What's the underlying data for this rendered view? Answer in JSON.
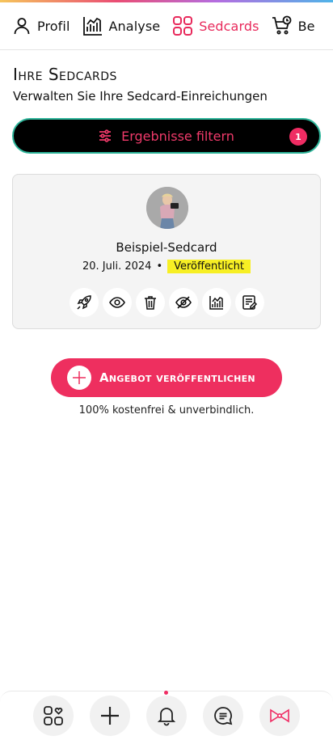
{
  "tabs": [
    {
      "label": "Profil",
      "icon": "user-icon",
      "active": false
    },
    {
      "label": "Analyse",
      "icon": "chart-icon",
      "active": false
    },
    {
      "label": "Sedcards",
      "icon": "grid-icon",
      "active": true
    },
    {
      "label": "Be",
      "icon": "cart-clock-icon",
      "active": false
    }
  ],
  "header": {
    "title": "Ihre Sedcards",
    "subtitle": "Verwalten Sie Ihre Sedcard-Einreichungen"
  },
  "filter": {
    "label": "Ergebnisse filtern",
    "badge": "1"
  },
  "card": {
    "title": "Beispiel-Sedcard",
    "date": "20. Juli. 2024",
    "separator": "•",
    "status": "Veröffentlicht",
    "actions": [
      "rocket-icon",
      "eye-icon",
      "trash-icon",
      "eye-off-icon",
      "chart-icon",
      "edit-note-icon"
    ]
  },
  "cta": {
    "label": "Angebot veröffentlichen",
    "note": "100% kostenfrei & unverbindlich."
  },
  "bottom_nav": [
    "apps-heart-icon",
    "plus-icon",
    "bell-icon",
    "chat-icon",
    "bow-icon"
  ],
  "colors": {
    "accent": "#ee2f5f",
    "filter_border": "#2eb59a",
    "status_highlight": "#f7ef24"
  }
}
